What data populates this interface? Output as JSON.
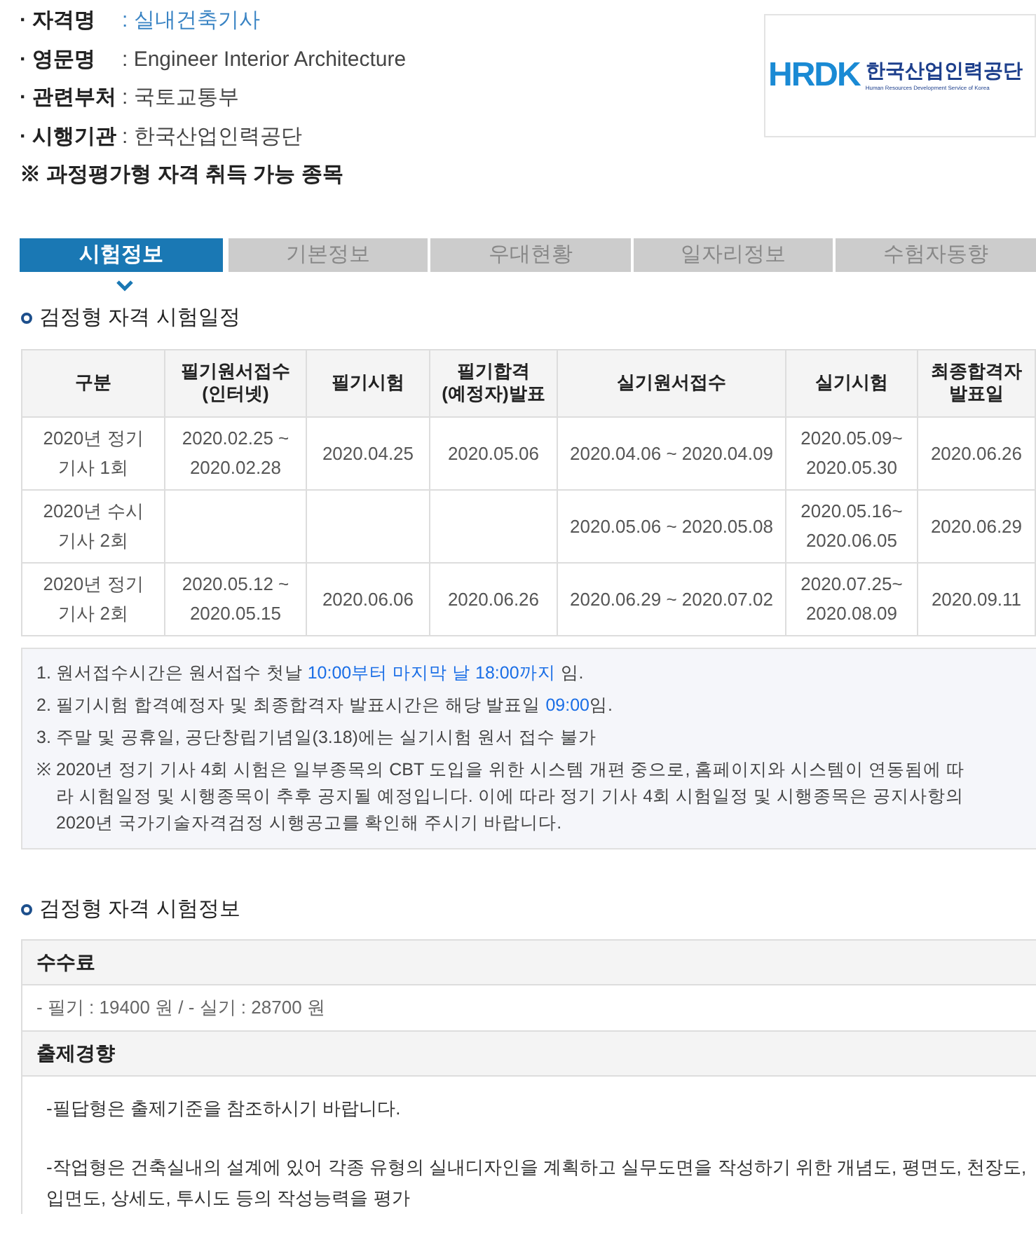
{
  "info": [
    {
      "label": "· 자격명",
      "value": ": 실내건축기사",
      "link": true
    },
    {
      "label": "· 영문명",
      "value": ": Engineer Interior Architecture",
      "link": false
    },
    {
      "label": "· 관련부처",
      "value": ": 국토교통부",
      "link": false
    },
    {
      "label": "· 시행기관",
      "value": ": 한국산업인력공단",
      "link": false
    }
  ],
  "notice": "※ 과정평가형 자격 취득 가능 종목",
  "logo": {
    "mark": "HRDK",
    "name": "한국산업인력공단",
    "subtitle": "Human Resources Development Service of Korea"
  },
  "tabs": [
    {
      "label": "시험정보",
      "selected": true
    },
    {
      "label": "기본정보",
      "selected": false
    },
    {
      "label": "우대현황",
      "selected": false
    },
    {
      "label": "일자리정보",
      "selected": false
    },
    {
      "label": "수험자동향",
      "selected": false
    }
  ],
  "schedule": {
    "title": "검정형 자격 시험일정",
    "columns": [
      "구분",
      "필기원서접수\n(인터넷)",
      "필기시험",
      "필기합격\n(예정자)발표",
      "실기원서접수",
      "실기시험",
      "최종합격자\n발표일"
    ],
    "rows": [
      [
        "2020년 정기\n기사 1회",
        "2020.02.25 ~\n2020.02.28",
        "2020.04.25",
        "2020.05.06",
        "2020.04.06 ~ 2020.04.09",
        "2020.05.09~\n2020.05.30",
        "2020.06.26"
      ],
      [
        "2020년 수시\n기사 2회",
        "",
        "",
        "",
        "2020.05.06 ~ 2020.05.08",
        "2020.05.16~\n2020.06.05",
        "2020.06.29"
      ],
      [
        "2020년 정기\n기사 2회",
        "2020.05.12 ~\n2020.05.15",
        "2020.06.06",
        "2020.06.26",
        "2020.06.29 ~ 2020.07.02",
        "2020.07.25~\n2020.08.09",
        "2020.09.11"
      ]
    ]
  },
  "notes": [
    {
      "parts": [
        {
          "text": "1. 원서접수시간은 원서접수 첫날 ",
          "highlight": false
        },
        {
          "text": "10:00부터 마지막 날 18:00까지",
          "highlight": true
        },
        {
          "text": " 임.",
          "highlight": false
        }
      ]
    },
    {
      "parts": [
        {
          "text": "2. 필기시험 합격예정자 및 최종합격자 발표시간은 해당 발표일 ",
          "highlight": false
        },
        {
          "text": "09:00",
          "highlight": true
        },
        {
          "text": "임.",
          "highlight": false
        }
      ]
    },
    {
      "parts": [
        {
          "text": "3. 주말 및 공휴일, 공단창립기념일(3.18)에는 실기시험 원서 접수 불가",
          "highlight": false
        }
      ]
    }
  ],
  "remark": {
    "mark": "※",
    "text": "2020년 정기 기사 4회 시험은 일부종목의 CBT 도입을 위한 시스템 개편 중으로, 홈페이지와 시스템이 연동됨에 따라 시험일정 및 시행종목이 추후 공지될 예정입니다. 이에 따라 정기 기사 4회 시험일정 및 시행종목은 공지사항의 2020년 국가기술자격검정 시행공고를 확인해 주시기 바랍니다."
  },
  "exam_info": {
    "title": "검정형 자격 시험정보",
    "sections": [
      {
        "heading": "수수료",
        "lines": [
          "- 필기 : 19400 원 / - 실기 : 28700 원"
        ],
        "kind": "fee"
      },
      {
        "heading": "출제경향",
        "lines": [
          "-필답형은 출제기준을 참조하시기 바랍니다.",
          "-작업형은 건축실내의 설계에 있어 각종 유형의 실내디자인을 계획하고 실무도면을 작성하기 위한 개념도, 평면도, 천장도, 입면도, 상세도, 투시도 등의 작성능력을 평가"
        ],
        "kind": "text"
      }
    ]
  }
}
